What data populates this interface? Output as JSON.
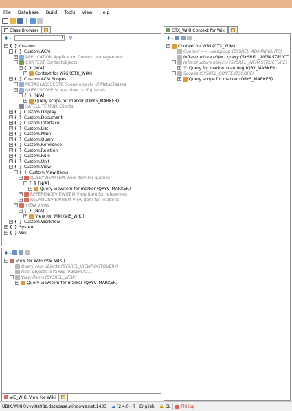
{
  "menu": [
    "File",
    "Database",
    "Build",
    "Tools",
    "View",
    "Help"
  ],
  "left_tabs": {
    "active": "Class Browser"
  },
  "class_tree": [
    {
      "d": 0,
      "e": "-",
      "i": "curly",
      "t": "Custom"
    },
    {
      "d": 1,
      "e": "-",
      "i": "curly",
      "t": "Custom.ACM"
    },
    {
      "d": 2,
      "e": "+",
      "i": "app",
      "t": "APPLICATION Application Context Management",
      "g": true
    },
    {
      "d": 2,
      "e": "-",
      "i": "ctx",
      "t": "CONTEXT Contextobjects",
      "g": true
    },
    {
      "d": 3,
      "e": "-",
      "i": "curly",
      "t": "[N/A]"
    },
    {
      "d": 4,
      "e": "+",
      "i": "obj",
      "t": "Context for Wiki (CTX_WIKI)"
    },
    {
      "d": 1,
      "e": "-",
      "i": "curly",
      "t": "Custom.ACM.Scopes"
    },
    {
      "d": 2,
      "e": "+",
      "i": "meta",
      "t": "METACLASSSCOPE Scope objects of MetaClasses",
      "g": true
    },
    {
      "d": 2,
      "e": "-",
      "i": "meta",
      "t": "QUERYSCOPE Scope objects of queries",
      "g": true
    },
    {
      "d": 3,
      "e": "-",
      "i": "curly",
      "t": "[N/A]"
    },
    {
      "d": 4,
      "e": "+",
      "i": "obj",
      "t": "Query scope for marker (QRYS_MARKER)"
    },
    {
      "d": 2,
      "e": "",
      "i": "sat",
      "t": "SATELLITE UBIK Clients",
      "g": true
    },
    {
      "d": 1,
      "e": "+",
      "i": "curly",
      "t": "Custom.Display"
    },
    {
      "d": 1,
      "e": "+",
      "i": "curly",
      "t": "Custom.Document"
    },
    {
      "d": 1,
      "e": "+",
      "i": "curly",
      "t": "Custom.Interface"
    },
    {
      "d": 1,
      "e": "+",
      "i": "curly",
      "t": "Custom.List"
    },
    {
      "d": 1,
      "e": "+",
      "i": "curly",
      "t": "Custom.Main"
    },
    {
      "d": 1,
      "e": "+",
      "i": "curly",
      "t": "Custom.Query"
    },
    {
      "d": 1,
      "e": "+",
      "i": "curly",
      "t": "Custom.Reference"
    },
    {
      "d": 1,
      "e": "+",
      "i": "curly",
      "t": "Custom.Relation"
    },
    {
      "d": 1,
      "e": "+",
      "i": "curly",
      "t": "Custom.Rule"
    },
    {
      "d": 1,
      "e": "+",
      "i": "curly",
      "t": "Custom.Unit"
    },
    {
      "d": 1,
      "e": "-",
      "i": "curly",
      "t": "Custom.View"
    },
    {
      "d": 2,
      "e": "-",
      "i": "curly",
      "t": "Custom.View.Items"
    },
    {
      "d": 3,
      "e": "-",
      "i": "view",
      "t": "QUERYVIEWITEM View item for queries",
      "g": true
    },
    {
      "d": 4,
      "e": "-",
      "i": "curly",
      "t": "[N/A]"
    },
    {
      "d": 5,
      "e": "+",
      "i": "obj",
      "t": "Query viewitem for marker (QRYV_MARKER)"
    },
    {
      "d": 3,
      "e": "+",
      "i": "view",
      "t": "REFERENCEVIEWITEM View item for references",
      "g": true
    },
    {
      "d": 3,
      "e": "+",
      "i": "view",
      "t": "RELATIONVIEWITEM View item for relations",
      "g": true
    },
    {
      "d": 2,
      "e": "-",
      "i": "view",
      "t": "VIEW Views",
      "g": true
    },
    {
      "d": 3,
      "e": "-",
      "i": "curly",
      "t": "[N/A]"
    },
    {
      "d": 4,
      "e": "+",
      "i": "obj",
      "t": "View for Wiki (VIE_WIKI)"
    },
    {
      "d": 1,
      "e": "+",
      "i": "curly",
      "t": "Custom.Workflow"
    },
    {
      "d": 0,
      "e": "+",
      "i": "curly",
      "t": "System"
    },
    {
      "d": 0,
      "e": "+",
      "i": "curly",
      "t": "Wiki"
    }
  ],
  "view_tree": [
    {
      "d": 0,
      "e": "-",
      "i": "view",
      "t": "View for Wiki (VIE_WIKI)"
    },
    {
      "d": 1,
      "e": "",
      "i": "sm",
      "t": "Query root objects (SYSREL_VIEWROOTQUERY)",
      "g": true,
      "it": true
    },
    {
      "d": 1,
      "e": "",
      "i": "sm",
      "t": "Root objects (SYSREL_VIEWROOT)",
      "g": true,
      "it": true
    },
    {
      "d": 1,
      "e": "-",
      "i": "sm",
      "t": "View items (SYSREL_VIEW)",
      "g": true,
      "it": true
    },
    {
      "d": 2,
      "e": "+",
      "i": "obj",
      "t": "Query viewitem for marker (QRYV_MARKER)"
    }
  ],
  "bottom_tab": "VIE_WIKI View for Wiki",
  "right_tab": "CTX_WIKI Context for Wiki",
  "ctx_tree": [
    {
      "d": 0,
      "e": "-",
      "i": "obj",
      "t": "Context for Wiki (CTX_WIKI)"
    },
    {
      "d": 1,
      "e": "",
      "i": "sm",
      "t": "Context => Usergroup (SYSREL_ADMINRIGHTS)",
      "g": true,
      "it": true
    },
    {
      "d": 1,
      "e": "",
      "i": "sm",
      "t": "Infrastructure object query (SYSREL_INFRASTRUCTUREQ)",
      "it": true
    },
    {
      "d": 1,
      "e": "-",
      "i": "sm",
      "t": "Infrastructure objects (SYSREL_INFRASTRUCTURE)",
      "g": true,
      "it": true
    },
    {
      "d": 2,
      "e": "+",
      "i": "filter",
      "t": "Query for marker scanning (QRY_MARKER)"
    },
    {
      "d": 1,
      "e": "-",
      "i": "sm",
      "t": "Scopes (SYSREL_CONTEXTSCOPE)",
      "g": true,
      "it": true
    },
    {
      "d": 2,
      "e": "+",
      "i": "obj",
      "t": "Query scope for marker (QRYS_MARKER)"
    }
  ],
  "status": {
    "connection": "UBIK.WIKI@vvvi8s98z.database.windows.net,1433",
    "version": "[2.4.0 - ]",
    "language": "English",
    "sl": "SL",
    "user": "Philipp"
  }
}
